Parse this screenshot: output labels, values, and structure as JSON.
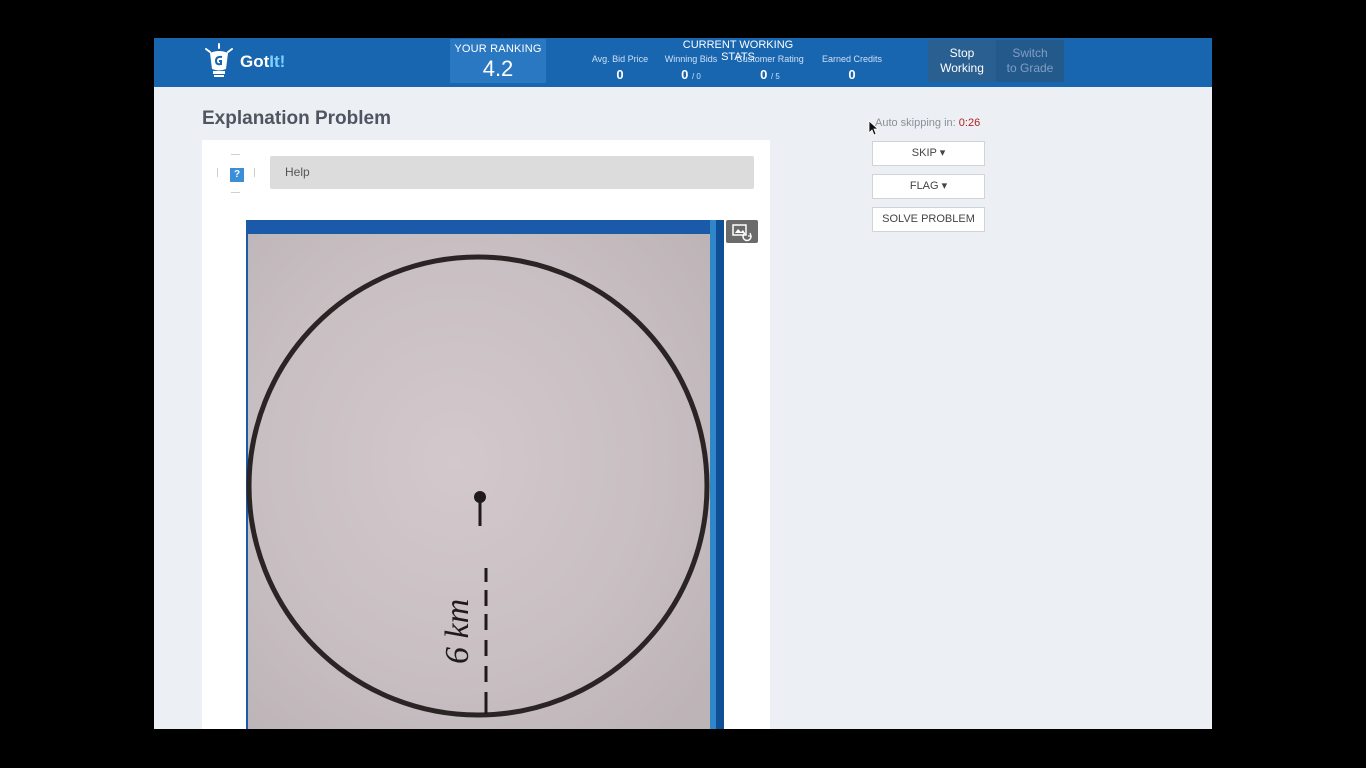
{
  "header": {
    "logo_got": "Got",
    "logo_it": "It!",
    "ranking_label": "YOUR RANKING",
    "ranking_value": "4.2",
    "stats_title": "CURRENT WORKING STATS",
    "stats": [
      {
        "label": "Avg. Bid Price",
        "value": "0",
        "suffix": ""
      },
      {
        "label": "Winning Bids",
        "value": "0",
        "suffix": "/ 0"
      },
      {
        "label": "Customer Rating",
        "value": "0",
        "suffix": "/ 5"
      },
      {
        "label": "Earned Credits",
        "value": "0",
        "suffix": ""
      }
    ],
    "stop_line1": "Stop",
    "stop_line2": "Working",
    "switch_line1": "Switch",
    "switch_line2": "to Grade"
  },
  "main": {
    "title": "Explanation Problem",
    "help_icon": "?",
    "help_label": "Help",
    "image_annotation": "6 km"
  },
  "sidebar": {
    "autoskip_label": "Auto skipping in:",
    "autoskip_time": "0:26",
    "skip_label": "SKIP ▾",
    "flag_label": "FLAG ▾",
    "solve_label": "SOLVE PROBLEM"
  },
  "icons": {
    "logo": "lightbulb-logo-icon",
    "help": "question-icon",
    "image_tool": "image-rotate-icon",
    "cursor": "mouse-cursor-icon"
  },
  "colors": {
    "header": "#1865b0",
    "ranking_bg": "#2b78c2",
    "page_bg": "#eceff4",
    "timer": "#b22222"
  }
}
